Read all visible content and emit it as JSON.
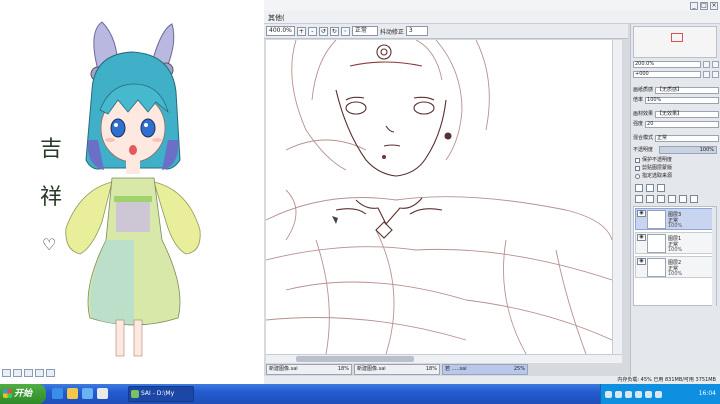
{
  "left_art": {
    "calligraphy": "吉 祥",
    "heart": "♡"
  },
  "sai": {
    "menu": "其他(",
    "toolbar": {
      "zoom": "400.0%",
      "blend_mode": "正常",
      "stabilizer_label": "抖动修正",
      "stabilizer_value": "3"
    },
    "panel": {
      "nav_zoom": "200.0%",
      "nav_angle": "+000",
      "paper_texture_label": "画纸质感",
      "paper_texture_value": "【无质感】",
      "paper_effect_label": "画材效果",
      "paper_effect_value": "【无效果】",
      "scale_label": "倍率",
      "scale_value": "100%",
      "strength_label": "强度",
      "strength_value": "20",
      "blend_label": "混合模式",
      "blend_value": "正常",
      "opacity_label": "不透明度",
      "opacity_value": "100%",
      "check_protect": "保护不透明度",
      "check_clip": "剪贴图层蒙版",
      "check_select": "指定选取来源"
    },
    "layers": [
      {
        "name": "图层3",
        "mode": "正常",
        "opacity": "100%"
      },
      {
        "name": "图层1",
        "mode": "正常",
        "opacity": "100%"
      },
      {
        "name": "图层2",
        "mode": "正常",
        "opacity": "100%"
      }
    ],
    "doc_tabs": [
      {
        "name": "新建图像.sai",
        "pct": "18%"
      },
      {
        "name": "新建图像.sai",
        "pct": "18%"
      },
      {
        "name": "若  .....sai",
        "pct": "25%"
      }
    ],
    "status": "内存负载: 45%  已用 831MB/可用 3751MB"
  },
  "taskbar": {
    "start_label": "开始",
    "task_item": "SAI - D:\\My Docu...",
    "clock": "16:04"
  }
}
